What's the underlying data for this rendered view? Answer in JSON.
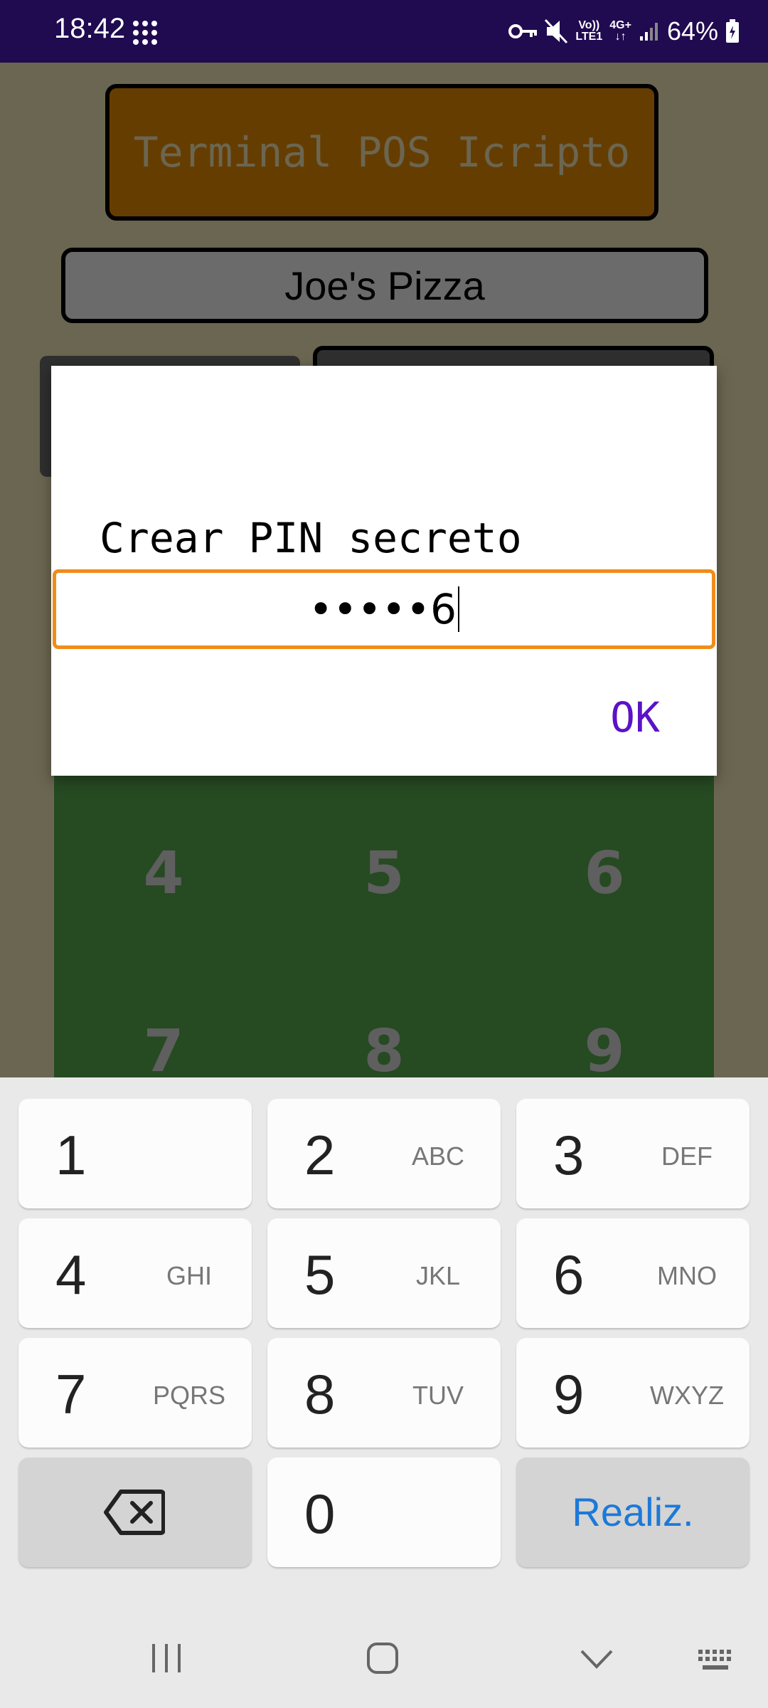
{
  "status_bar": {
    "time": "18:42",
    "battery": "64%",
    "network_top": "Vo))",
    "network_bottom": "LTE1",
    "net_type": "4G+",
    "icons": [
      "apps-grid-icon",
      "vpn-key-icon",
      "mute-icon",
      "signal-icon",
      "battery-icon"
    ]
  },
  "app": {
    "title": "Terminal POS Icripto",
    "merchant": "Joe's Pizza",
    "background_keys": [
      "4",
      "5",
      "6",
      "7",
      "8",
      "9"
    ]
  },
  "dialog": {
    "title": "Crear PIN secreto",
    "pin_value": "•••••6",
    "ok_label": "OK"
  },
  "keyboard": {
    "keys": [
      {
        "num": "1",
        "letters": ""
      },
      {
        "num": "2",
        "letters": "ABC"
      },
      {
        "num": "3",
        "letters": "DEF"
      },
      {
        "num": "4",
        "letters": "GHI"
      },
      {
        "num": "5",
        "letters": "JKL"
      },
      {
        "num": "6",
        "letters": "MNO"
      },
      {
        "num": "7",
        "letters": "PQRS"
      },
      {
        "num": "8",
        "letters": "TUV"
      },
      {
        "num": "9",
        "letters": "WXYZ"
      },
      {
        "num": "0",
        "letters": ""
      }
    ],
    "done_label": "Realiz."
  },
  "colors": {
    "status_bar": "#200a50",
    "title_bg": "#663d00",
    "dialog_accent": "#f08c1a",
    "ok_color": "#5a12c8",
    "done_color": "#1c79d8"
  }
}
